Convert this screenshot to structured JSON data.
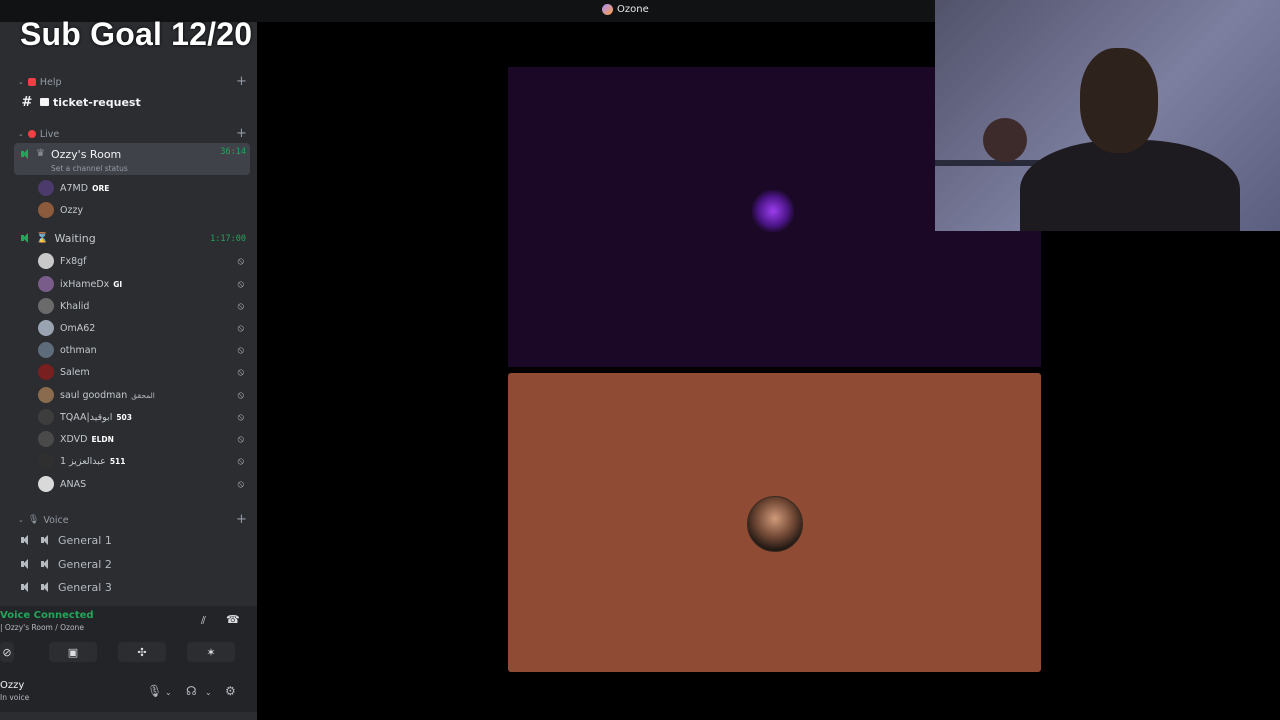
{
  "overlay": {
    "sub_goal": "Sub Goal 12/20"
  },
  "window": {
    "server_name": "Ozone",
    "server_icon": "server-avatar-icon"
  },
  "sidebar": {
    "categories": {
      "help": {
        "label": "Help",
        "icon": "bookmark-emoji",
        "color": "#f23f43"
      },
      "live": {
        "label": "Live",
        "icon": "red-circle-emoji",
        "color": "#f23f43"
      },
      "voice": {
        "label": "Voice",
        "icon": "microphone-emoji",
        "color": "#949ba4"
      }
    },
    "ticket_channel": {
      "name": "ticket-request",
      "icon": "hash-icon"
    },
    "ozzys_room": {
      "name": "Ozzy's Room",
      "status": "Set a channel status",
      "timer": "36:14",
      "users": [
        {
          "name": "A7MD",
          "tag": "ORE",
          "avatar_color": "#4b3a6b"
        },
        {
          "name": "Ozzy",
          "tag": "",
          "avatar_color": "#8c5a3c"
        }
      ]
    },
    "waiting": {
      "name": "Waiting",
      "timer": "1:17:00",
      "users": [
        {
          "name": "Fx8gf",
          "tag": "",
          "avatar_color": "#c9c9c9"
        },
        {
          "name": "ixHameDx",
          "tag": "GI",
          "avatar_color": "#7a5c8a"
        },
        {
          "name": "Khalid",
          "tag": "",
          "avatar_color": "#6a6a6a"
        },
        {
          "name": "OmA62",
          "tag": "",
          "avatar_color": "#9aa3b0"
        },
        {
          "name": "othman",
          "tag": "",
          "avatar_color": "#5d6b7a"
        },
        {
          "name": "Salem",
          "tag": "",
          "avatar_color": "#7a1f1f"
        },
        {
          "name": "saul goodman",
          "tag": "المحقق",
          "avatar_color": "#8a6b4e"
        },
        {
          "name": "TQAA|ابوقيد",
          "tag": "503",
          "avatar_color": "#3d3d3d"
        },
        {
          "name": "XDVD",
          "tag": "ELDN",
          "avatar_color": "#4a4a4a"
        },
        {
          "name": "عبدالعزيز 1",
          "tag": "511",
          "avatar_color": "#2f2f2f"
        },
        {
          "name": "ANAS",
          "tag": "",
          "avatar_color": "#d9d9d9"
        }
      ]
    },
    "voice_channels": [
      {
        "name": "General 1"
      },
      {
        "name": "General 2"
      },
      {
        "name": "General 3"
      }
    ]
  },
  "voice_panel": {
    "connected": "Voice Connected",
    "location": "| Ozzy's Room / Ozone"
  },
  "user_panel": {
    "name": "Ozzy",
    "status": "In voice"
  },
  "colors": {
    "accent_green": "#23a55a",
    "sidebar_bg": "#2b2d31",
    "stage_top_bg": "#1a0826",
    "stage_bottom_bg": "#8f4b33"
  }
}
